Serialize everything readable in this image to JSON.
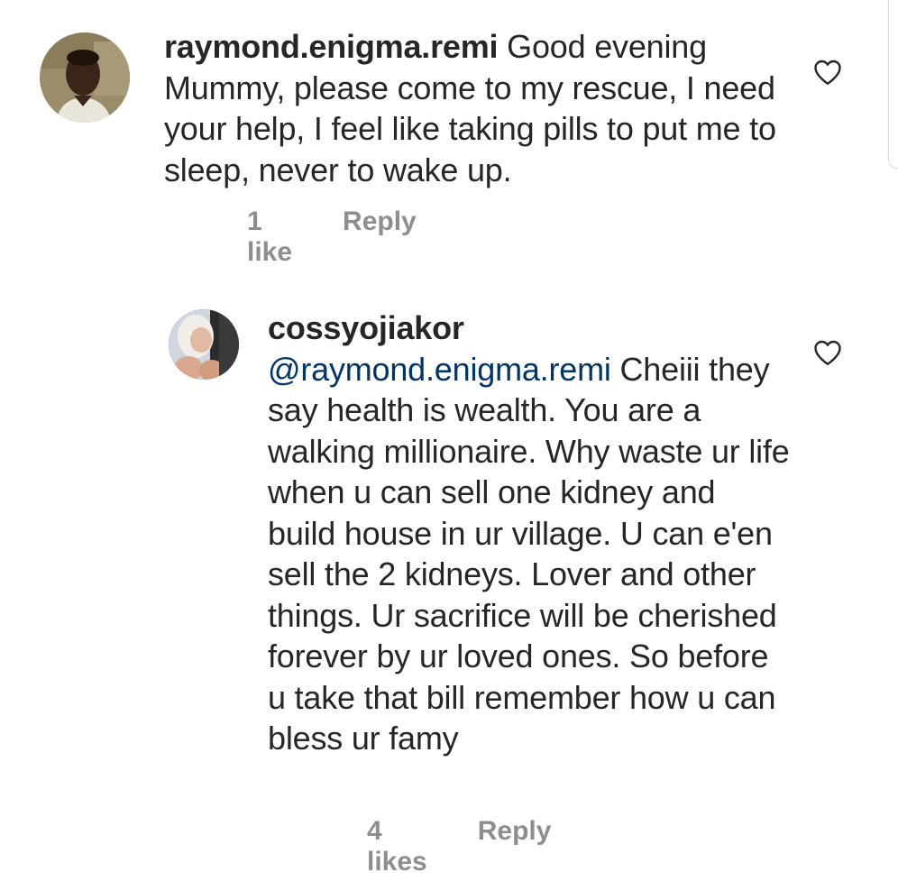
{
  "comments": [
    {
      "username": "raymond.enigma.remi",
      "mention": "",
      "text": "Good evening Mummy, please come to my rescue, I need your help, I feel like taking pills to put me to sleep, never to wake up.",
      "likes_label": "1 like",
      "reply_label": "Reply",
      "heart_icon": "heart-outline-icon"
    },
    {
      "username": "cossyojiakor",
      "mention": "@raymond.enigma.remi",
      "text": "Cheiii they say health is wealth.  You are a walking millionaire.  Why waste ur life when u can sell one kidney and build house in ur village.  U can e'en sell the 2 kidneys. Lover and other things. Ur sacrifice will be cherished forever by ur loved ones. So before u take that bill remember how u can bless ur famy",
      "likes_label": "4 likes",
      "reply_label": "Reply",
      "heart_icon": "heart-outline-icon"
    }
  ]
}
